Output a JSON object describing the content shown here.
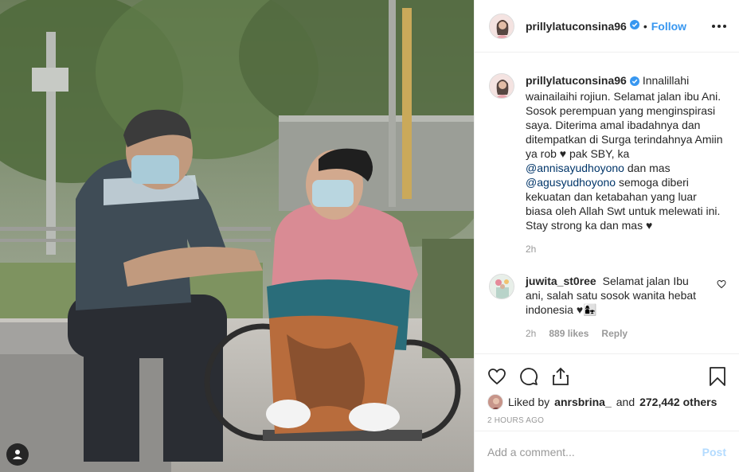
{
  "post": {
    "author": "prillylatuconsina96",
    "follow_label": "Follow",
    "separator": "•",
    "caption": {
      "author": "prillylatuconsina96",
      "text_1": "Innalillahi wainailaihi rojiun. Selamat jalan ibu Ani. Sosok perempuan yang menginspirasi saya. Diterima amal ibadahnya dan ditempatkan di Surga terindahnya Amiin ya rob ♥ pak SBY, ka ",
      "mention_1": "@annisayudhoyono",
      "text_2": " dan mas ",
      "mention_2": "@agusyudhoyono",
      "text_3": " semoga diberi kekuatan dan ketabahan yang luar biasa oleh Allah Swt untuk melewati ini. Stay strong ka dan mas ♥",
      "age": "2h"
    },
    "comments": [
      {
        "author": "juwita_st0ree",
        "text": "Selamat jalan Ibu ani, salah satu sosok wanita hebat indonesia ♥👩‍👧",
        "age": "2h",
        "likes": "889 likes",
        "reply_label": "Reply"
      }
    ],
    "liked_by": {
      "prefix": "Liked by",
      "user": "anrsbrina_",
      "conjunction": "and",
      "others": "272,442 others"
    },
    "timestamp": "2 HOURS AGO",
    "add_comment": {
      "placeholder": "Add a comment...",
      "post_label": "Post"
    }
  },
  "icons": {
    "verified": "verified-badge-icon",
    "more": "more-options-icon",
    "like": "heart-icon",
    "comment": "comment-icon",
    "share": "share-icon",
    "save": "bookmark-icon",
    "tag": "user-tag-icon"
  },
  "colors": {
    "accent": "#3897f0",
    "mention": "#003569",
    "muted": "#999999",
    "post_disabled": "#b3dbff"
  }
}
